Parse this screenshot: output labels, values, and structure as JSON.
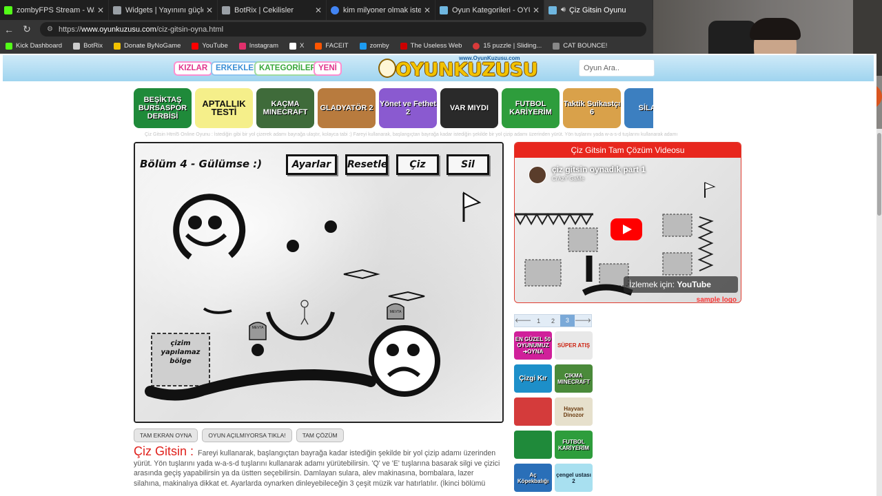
{
  "browser": {
    "tabs": [
      {
        "title": "zombyFPS Stream - Watch Live on",
        "favicon_color": "#53fc18"
      },
      {
        "title": "Widgets | Yayınını güçlendirmek i",
        "favicon_color": "#9aa0a6"
      },
      {
        "title": "BotRix | Cekilisler",
        "favicon_color": "#9aa0a6"
      },
      {
        "title": "kim milyoner olmak ister oyna - G",
        "favicon_color": "#4285f4"
      },
      {
        "title": "Oyun Kategorileri - OYUN KUZUSU",
        "favicon_color": "#6fb7e0"
      },
      {
        "title": "Çiz Gitsin Oyunu",
        "favicon_color": "#6fb7e0"
      }
    ],
    "url_prefix": "https://",
    "url_host": "www.oyunkuzusu.com",
    "url_path": "/ciz-gitsin-oyna.html",
    "bookmarks": [
      {
        "label": "Kick Dashboard",
        "color": "#53fc18"
      },
      {
        "label": "BotRix",
        "color": "#cccccc"
      },
      {
        "label": "Donate ByNoGame",
        "color": "#f2c200"
      },
      {
        "label": "YouTube",
        "color": "#ff0000"
      },
      {
        "label": "Instagram",
        "color": "#e1306c"
      },
      {
        "label": "X",
        "color": "#ffffff"
      },
      {
        "label": "FACEIT",
        "color": "#ff5500"
      },
      {
        "label": "zomby",
        "color": "#1d9bf0"
      },
      {
        "label": "The Useless Web",
        "color": "#cc0000"
      },
      {
        "label": "15 puzzle | Sliding...",
        "color": "#d93a3a"
      },
      {
        "label": "CAT BOUNCE!",
        "color": "#888888"
      }
    ]
  },
  "site": {
    "nav": [
      {
        "label": "KIZLAR",
        "color": "#e0338c"
      },
      {
        "label": "ERKEKLER",
        "color": "#3a8fd6"
      },
      {
        "label": "KATEGORİLER",
        "color": "#3aa83a"
      },
      {
        "label": "YENİ",
        "color": "#e0338c"
      }
    ],
    "logo_sub": "www.OyunKuzusu.com",
    "logo_main": "OYUNKUZUSU",
    "search_placeholder": "Oyun Ara..",
    "top_games": [
      {
        "label": "BEŞİKTAŞ BURSASPOR DERBİSİ",
        "bg": "#1f8a3a"
      },
      {
        "label": "APTALLIK TESTİ",
        "bg": "#f5ef8a"
      },
      {
        "label": "KAÇMA MINECRAFT",
        "bg": "#3f6b3a"
      },
      {
        "label": "GLADYATÖR 2",
        "bg": "#b87b3e"
      },
      {
        "label": "Yönet ve Fethet 2",
        "bg": "#8a5ad0"
      },
      {
        "label": "VAR MIYDI",
        "bg": "#2a2a2a"
      },
      {
        "label": "FUTBOL KARİYERİM",
        "bg": "#2e9d3c"
      },
      {
        "label": "Taktik Suikastçı 6",
        "bg": "#d9a14a"
      },
      {
        "label": "SİLAHLI",
        "bg": "#3c7fc0"
      }
    ],
    "crumb": "Çiz Gitsin Html5 Online Oyunu : İstediğin gibi bir yol çizerek adamı bayrağa ulaştır, kolayca tabi :) Fareyi kullanarak, başlangıçtan bayrağa kadar istediğin şekilde bir yol çizip adamı üzerinden yürüt. Yön tuşlarını yada w-a-s-d tuşlarını kullanarak adamı"
  },
  "game": {
    "level_title": "Bölüm 4 - Gülümse :)",
    "buttons": [
      "Ayarlar",
      "Resetle",
      "Çiz",
      "Sil"
    ],
    "zone_label": "çizim yapılamaz bölge",
    "bomb_label": "MEVTA"
  },
  "actions": {
    "fullscreen": "TAM EKRAN OYNA",
    "not_opening": "OYUN AÇILMIYORSA TIKLA!",
    "solution": "TAM ÇÖZÜM"
  },
  "description": {
    "name": "Çiz Gitsin :",
    "text": "Fareyi kullanarak, başlangıçtan bayrağa kadar istediğin şekilde bir yol çizip adamı üzerinden yürüt. Yön tuşlarını yada w-a-s-d tuşlarını kullanarak adamı yürütebilirsin. 'Q' ve 'E' tuşlarına basarak silgi ve çizici arasında geçiş yapabilirsin ya da üstten seçebilirsin. Damlayan sulara, alev makinasına, bombalara, lazer silahına, makinalıya dikkat et. Ayarlarda oynarken dinleyebileceğin 3 çeşit müzik var hatırlatılır. (İkinci bölümü"
  },
  "video": {
    "header": "Çiz Gitsin Tam Çözüm Videosu",
    "title": "çiz gitsin oynadık part 1",
    "channel": "CrAzY GaMe",
    "watch_on": "İzlemek için:",
    "youtube": "YouTube",
    "sample": "sample logo"
  },
  "pager": {
    "prev": "🡐",
    "pages": [
      "1",
      "2",
      "3"
    ],
    "current": "3",
    "next": "🡒"
  },
  "side_games": [
    {
      "label": "EN GÜZEL 50 OYUNUMUZ ➜OYNA",
      "bg": "#d0209a"
    },
    {
      "label": "SÜPER ATIŞ",
      "bg": "#e8e8e8"
    },
    {
      "label": "Çizgi Kır",
      "bg": "#1d8fc9"
    },
    {
      "label": "ÇIKMA MINECRAFT",
      "bg": "#4a8a3a"
    },
    {
      "label": "",
      "bg": "#d43b3b"
    },
    {
      "label": "Hayvan Dinozor",
      "bg": "#e6e0cc"
    },
    {
      "label": "",
      "bg": "#1f8a3a"
    },
    {
      "label": "FUTBOL KARİYERİM",
      "bg": "#2e9d3c"
    },
    {
      "label": "Aç Köpekbalığı",
      "bg": "#2a6fb8"
    },
    {
      "label": "çengel ustası 2",
      "bg": "#a8e0f0"
    }
  ]
}
